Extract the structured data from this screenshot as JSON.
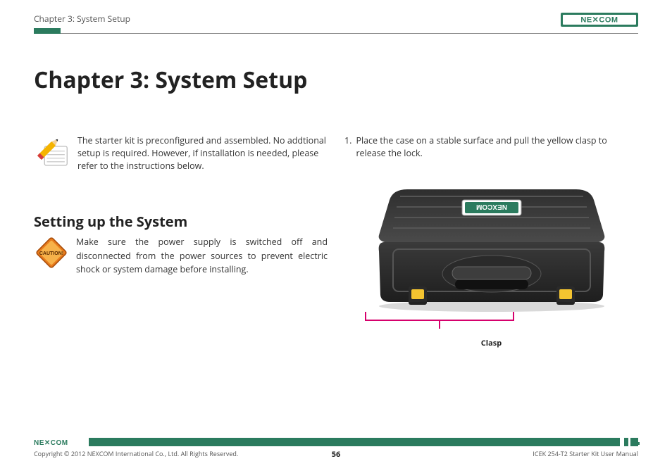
{
  "header": {
    "breadcrumb": "Chapter 3: System Setup",
    "brand": "NEXCOM"
  },
  "chapter": {
    "title": "Chapter 3: System Setup"
  },
  "note": {
    "text": "The starter kit is preconfigured and assembled. No addtional setup is required. However, if installation is needed, please refer to the instructions below."
  },
  "section": {
    "heading": "Setting up the System",
    "caution_label": "CAUTION!",
    "caution_text": "Make sure the power supply is switched off and disconnected from the power sources to prevent electric shock or system damage before installing."
  },
  "steps": [
    {
      "num": "1.",
      "text": "Place the case on a stable surface and pull the yellow clasp to release the lock."
    }
  ],
  "figure": {
    "clasp_label": "Clasp",
    "case_brand": "NEXCOM"
  },
  "footer": {
    "brand": "NEXCOM",
    "copyright": "Copyright © 2012 NEXCOM International Co., Ltd. All Rights Reserved.",
    "page": "56",
    "doc": "ICEK 254-T2 Starter Kit User Manual"
  }
}
